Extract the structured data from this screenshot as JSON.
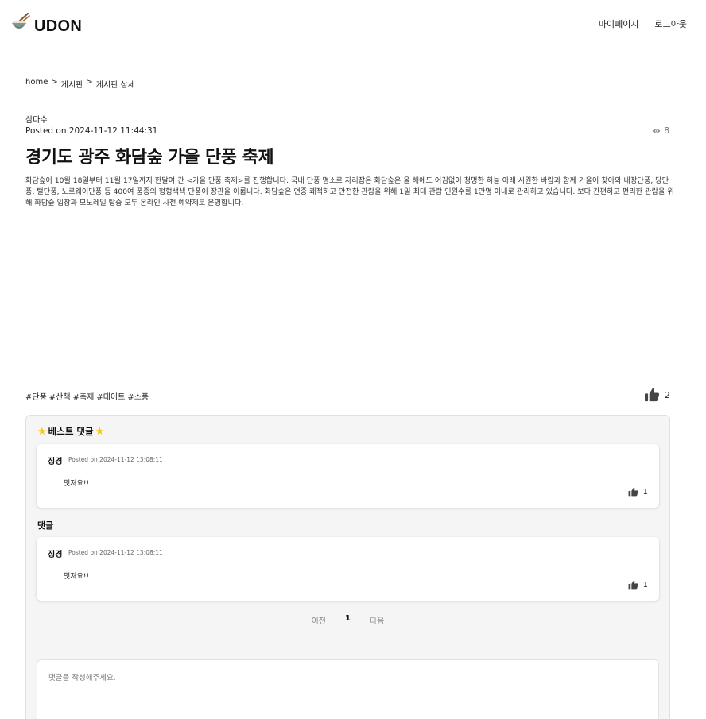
{
  "header": {
    "logo_text": "UDON",
    "nav": {
      "mypage": "마이페이지",
      "logout": "로그아웃"
    }
  },
  "breadcrumb": {
    "home": "home",
    "sep1": ">",
    "board": "게시판",
    "sep2": ">",
    "detail": "게시판 상세"
  },
  "post": {
    "author": "삼다수",
    "posted_on": "Posted on 2024-11-12 11:44:31",
    "views": "8",
    "title": "경기도 광주 화담숲 가을 단풍 축제",
    "body": "화담숲이 10월 18일부터 11월 17일까지 한달여 간 <가을 단풍 축제>를 진행합니다. 국내 단풍 명소로 자리잡은 화담숲은 올 해에도 어김없이 청명한 하늘 아래 시원한 바람과 함께 가을이 찾아와 내장단풍, 당단풍, 털단풍, 노르웨이단풍 등 400여 품종의 형형색색 단풍이 장관을 이룹니다. 화담숲은 연중 쾌적하고 안전한 관람을 위해 1일 최대 관람 인원수를 1만명 이내로 관리하고 있습니다. 보다 간편하고 편리한 관람을 위해 화담숲 입장과 모노레일 탑승 모두 온라인 사전 예약제로 운영합니다.",
    "tags": [
      "#단풍",
      "#산책",
      "#축제",
      "#데이트",
      "#소풍"
    ],
    "likes": "2"
  },
  "comments": {
    "best_label": "베스트 댓글",
    "best": [
      {
        "user": "징경",
        "posted_on": "Posted on 2024-11-12 13:08:11",
        "text": "멋져요!!",
        "likes": "1"
      }
    ],
    "section_label": "댓글",
    "list": [
      {
        "user": "징경",
        "posted_on": "Posted on 2024-11-12 13:08:11",
        "text": "멋져요!!",
        "likes": "1"
      }
    ],
    "pagination": {
      "prev": "이전",
      "current": "1",
      "next": "다음"
    },
    "input_placeholder": "댓글을 작성해주세요."
  },
  "colors": {
    "star": "#f5c518",
    "box_bg": "#f5f5f5",
    "icon": "#444444"
  },
  "icons": [
    "udon-bowl-icon",
    "eye-icon",
    "thumbs-up-icon",
    "star-icon"
  ]
}
